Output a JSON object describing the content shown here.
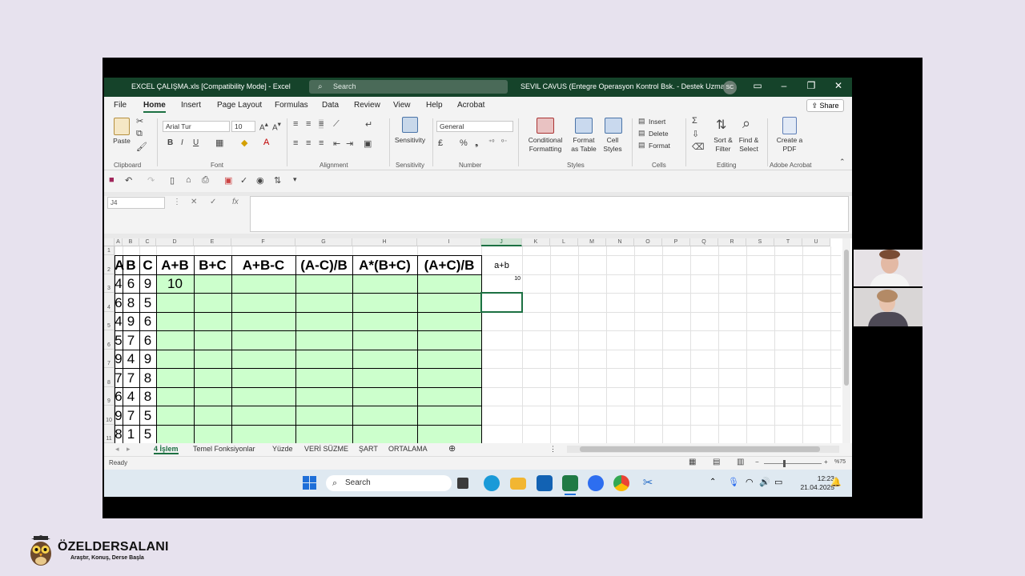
{
  "window": {
    "title": "EXCEL ÇALIŞMA.xls  [Compatibility Mode]  -  Excel",
    "search_placeholder": "Search",
    "user": "SEVIL CAVUS (Entegre Operasyon Kontrol Bsk. - Destek Uzmani)",
    "user_initials": "SC"
  },
  "ribbon": {
    "tabs": [
      "File",
      "Home",
      "Insert",
      "Page Layout",
      "Formulas",
      "Data",
      "Review",
      "View",
      "Help",
      "Acrobat"
    ],
    "active_tab": "Home",
    "share_label": "Share",
    "paste": "Paste",
    "font_name": "Arial Tur",
    "font_size": "10",
    "bold": "B",
    "italic": "I",
    "underline": "U",
    "sensitivity": "Sensitivity",
    "number_format": "General",
    "conditional_formatting": "Conditional Formatting",
    "format_as_table": "Format as Table",
    "cell_styles": "Cell Styles",
    "insert": "Insert",
    "delete": "Delete",
    "format": "Format",
    "sort_filter": "Sort & Filter",
    "find_select": "Find & Select",
    "create_pdf": "Create a PDF",
    "groups": [
      "Clipboard",
      "Font",
      "Alignment",
      "Sensitivity",
      "Number",
      "Styles",
      "Cells",
      "Editing",
      "Adobe Acrobat"
    ]
  },
  "formula_bar": {
    "name_box": "J4",
    "fx": "fx",
    "cancel": "✕",
    "enter": "✓"
  },
  "sheet": {
    "columns": [
      "A",
      "B",
      "C",
      "D",
      "E",
      "F",
      "G",
      "H",
      "I",
      "J",
      "K",
      "L",
      "M",
      "N",
      "O",
      "P",
      "Q",
      "R",
      "S",
      "T",
      "U"
    ],
    "selected_column": "J",
    "rows": [
      "1",
      "2",
      "3",
      "4",
      "5",
      "6",
      "7",
      "8",
      "9",
      "10",
      "11"
    ],
    "headers": [
      "A",
      "B",
      "C",
      "A+B",
      "B+C",
      "A+B-C",
      "(A-C)/B",
      "A*(B+C)",
      "(A+C)/B"
    ],
    "data": [
      [
        "4",
        "6",
        "9",
        "10"
      ],
      [
        "6",
        "8",
        "5"
      ],
      [
        "4",
        "9",
        "6"
      ],
      [
        "5",
        "7",
        "6"
      ],
      [
        "9",
        "4",
        "9"
      ],
      [
        "7",
        "7",
        "8"
      ],
      [
        "6",
        "4",
        "8"
      ],
      [
        "9",
        "7",
        "5"
      ],
      [
        "8",
        "1",
        "5"
      ]
    ],
    "note_j2": "a+b",
    "note_j3": "10",
    "fill_color": "#ccffcc"
  },
  "sheet_tabs": [
    "4 İşlem",
    "Temel Fonksiyonlar",
    "Yüzde",
    "VERİ SÜZME",
    "ŞART",
    "ORTALAMA"
  ],
  "active_sheet": "4 İşlem",
  "status": {
    "ready": "Ready",
    "zoom": "%75"
  },
  "taskbar": {
    "search": "Search",
    "time": "12:23",
    "date": "21.04.2025"
  },
  "branding": {
    "name": "ÖZELDERSALANI",
    "slogan": "Araştır, Konuş, Derse Başla"
  }
}
